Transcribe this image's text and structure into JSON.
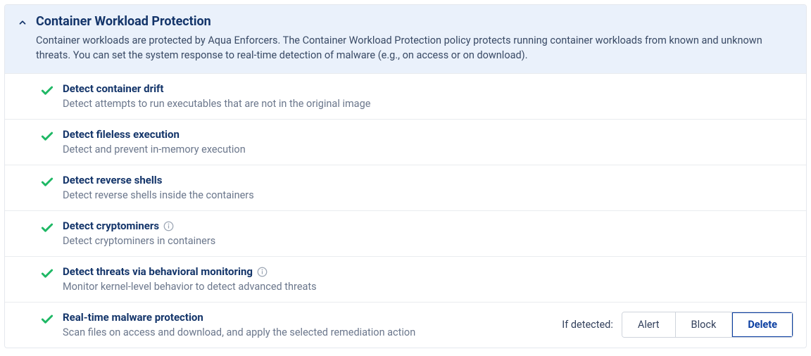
{
  "header": {
    "title": "Container Workload Protection",
    "description": "Container workloads are protected by Aqua Enforcers. The Container Workload Protection policy protects running container workloads from known and unknown threats. You can set the system response to real-time detection of malware (e.g., on access or on download)."
  },
  "items": [
    {
      "title": "Detect container drift",
      "description": "Detect attempts to run executables that are not in the original image",
      "info": false
    },
    {
      "title": "Detect fileless execution",
      "description": "Detect and prevent in-memory execution",
      "info": false
    },
    {
      "title": "Detect reverse shells",
      "description": "Detect reverse shells inside the containers",
      "info": false
    },
    {
      "title": "Detect cryptominers",
      "description": "Detect cryptominers in containers",
      "info": true
    },
    {
      "title": "Detect threats via behavioral monitoring",
      "description": "Monitor kernel-level behavior to detect advanced threats",
      "info": true
    },
    {
      "title": "Real-time malware protection",
      "description": "Scan files on access and download, and apply the selected remediation action",
      "info": false
    }
  ],
  "actions": {
    "label": "If detected:",
    "options": [
      "Alert",
      "Block",
      "Delete"
    ],
    "selected": "Delete"
  }
}
